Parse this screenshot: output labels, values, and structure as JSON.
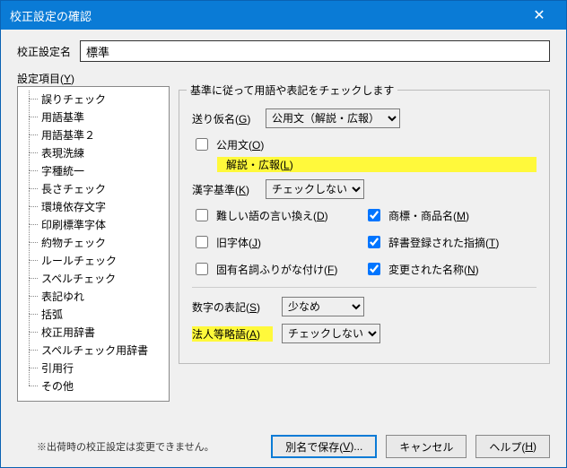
{
  "window": {
    "title": "校正設定の確認"
  },
  "name_row": {
    "label": "校正設定名",
    "value": "標準"
  },
  "items_label_pre": "設定項目(",
  "items_label_key": "Y",
  "items_label_post": ")",
  "tree": {
    "items": [
      {
        "label": "誤りチェック"
      },
      {
        "label": "用語基準"
      },
      {
        "label": "用語基準２"
      },
      {
        "label": "表現洗練"
      },
      {
        "label": "字種統一"
      },
      {
        "label": "長さチェック"
      },
      {
        "label": "環境依存文字"
      },
      {
        "label": "印刷標準字体"
      },
      {
        "label": "約物チェック"
      },
      {
        "label": "ルールチェック"
      },
      {
        "label": "スペルチェック"
      },
      {
        "label": "表記ゆれ"
      },
      {
        "label": "括弧"
      },
      {
        "label": "校正用辞書"
      },
      {
        "label": "スペルチェック用辞書"
      },
      {
        "label": "引用行"
      },
      {
        "label": "その他"
      }
    ]
  },
  "group": {
    "title": "基準に従って用語や表記をチェックします",
    "okurigana": {
      "label_pre": "送り仮名(",
      "key": "G",
      "label_post": ")",
      "value": "公用文（解説・広報）"
    },
    "koyobun": {
      "label_pre": "公用文(",
      "key": "O",
      "label_post": ")",
      "checked": false,
      "sub_pre": "解説・広報(",
      "sub_key": "L",
      "sub_post": ")",
      "sub_checked": false
    },
    "kanji": {
      "label_pre": "漢字基準(",
      "key": "K",
      "label_post": ")",
      "value": "チェックしない"
    },
    "muzukashii": {
      "label_pre": "難しい語の言い換え(",
      "key": "D",
      "label_post": ")",
      "checked": false
    },
    "shohyo": {
      "label_pre": "商標・商品名(",
      "key": "M",
      "label_post": ")",
      "checked": true
    },
    "kyujitai": {
      "label_pre": "旧字体(",
      "key": "J",
      "label_post": ")",
      "checked": false
    },
    "jisho": {
      "label_pre": "辞書登録された指摘(",
      "key": "T",
      "label_post": ")",
      "checked": true
    },
    "koyumeishi": {
      "label_pre": "固有名詞ふりがな付け(",
      "key": "F",
      "label_post": ")",
      "checked": false
    },
    "henkou": {
      "label_pre": "変更された名称(",
      "key": "N",
      "label_post": ")",
      "checked": true
    },
    "suuji": {
      "label_pre": "数字の表記(",
      "key": "S",
      "label_post": ")",
      "value": "少なめ"
    },
    "houjin": {
      "label_pre": "法人等略語(",
      "key": "A",
      "label_post": ")",
      "value": "チェックしない"
    }
  },
  "footer": {
    "note": "※出荷時の校正設定は変更できません。",
    "saveas_pre": "別名で保存(",
    "saveas_key": "V",
    "saveas_post": ")...",
    "cancel": "キャンセル",
    "help_pre": "ヘルプ(",
    "help_key": "H",
    "help_post": ")"
  }
}
